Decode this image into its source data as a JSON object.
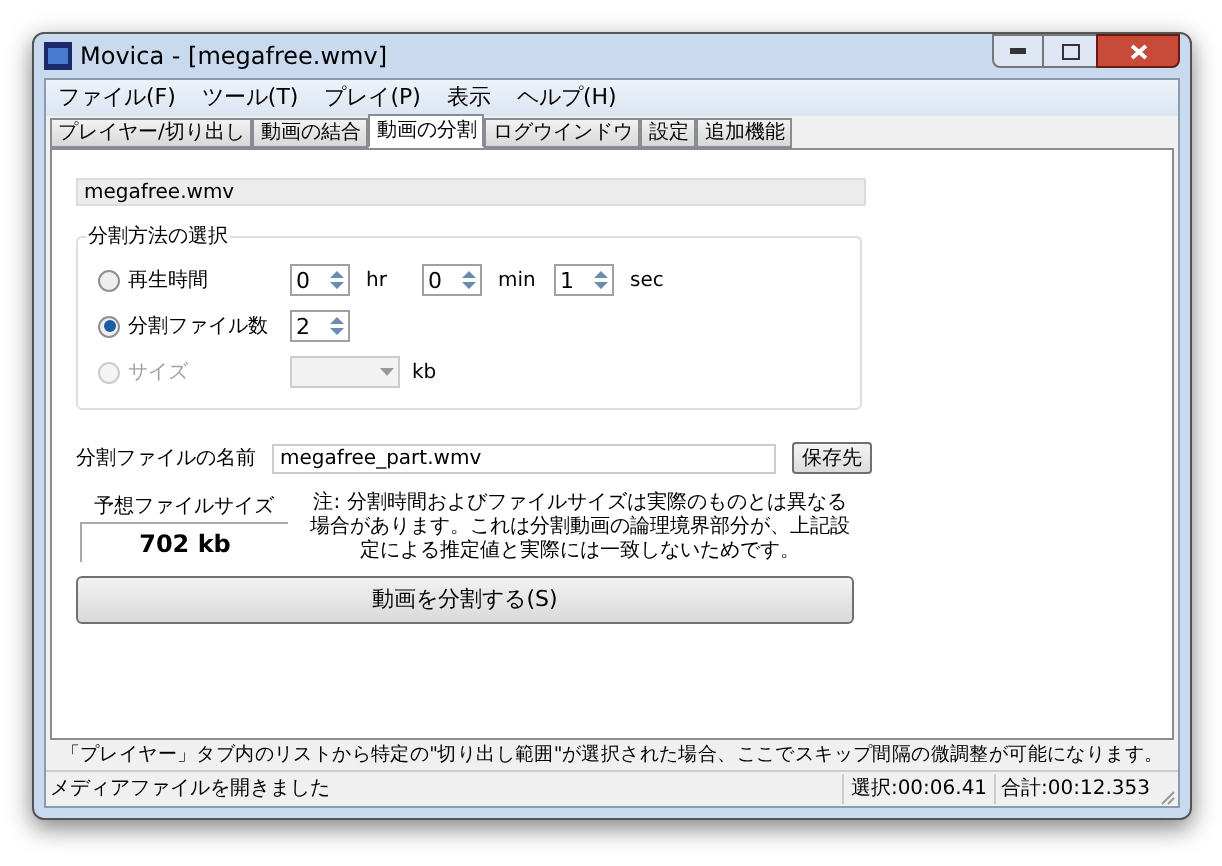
{
  "window": {
    "title": "Movica - [megafree.wmv]"
  },
  "menu": [
    "ファイル(F)",
    "ツール(T)",
    "プレイ(P)",
    "表示",
    "ヘルプ(H)"
  ],
  "tabs": [
    {
      "label": "プレイヤー/切り出し",
      "selected": false
    },
    {
      "label": "動画の結合",
      "selected": false
    },
    {
      "label": "動画の分割",
      "selected": true
    },
    {
      "label": "ログウインドウ",
      "selected": false
    },
    {
      "label": "設定",
      "selected": false
    },
    {
      "label": "追加機能",
      "selected": false
    }
  ],
  "file_field": {
    "value": "megafree.wmv"
  },
  "split_method": {
    "title": "分割方法の選択",
    "options": [
      {
        "kind": "time",
        "label": "再生時間",
        "selected": false,
        "disabled": false,
        "spinners": [
          {
            "value": "0",
            "unit": "hr"
          },
          {
            "value": "0",
            "unit": "min"
          },
          {
            "value": "1",
            "unit": "sec"
          }
        ]
      },
      {
        "kind": "count",
        "label": "分割ファイル数",
        "selected": true,
        "disabled": false,
        "spinners": [
          {
            "value": "2"
          }
        ]
      },
      {
        "kind": "size",
        "label": "サイズ",
        "selected": false,
        "disabled": true,
        "unit": "kb"
      }
    ]
  },
  "output_name": {
    "label": "分割ファイルの名前",
    "value": "megafree_part.wmv",
    "button": "保存先"
  },
  "estimate": {
    "label": "予想ファイルサイズ",
    "value": "702 kb"
  },
  "note": "注: 分割時間およびファイルサイズは実際のものとは異なる場合があります。これは分割動画の論理境界部分が、上記設定による推定値と実際には一致しないためです。",
  "split_button": "動画を分割する(S)",
  "hint": "「プレイヤー」タブ内のリストから特定の\"切り出し範囲\"が選択された場合、ここでスキップ間隔の微調整が可能になります。",
  "status_bar": {
    "message": "メディアファイルを開きました",
    "selection": "選択:00:06.41",
    "total": "合計:00:12.353"
  }
}
